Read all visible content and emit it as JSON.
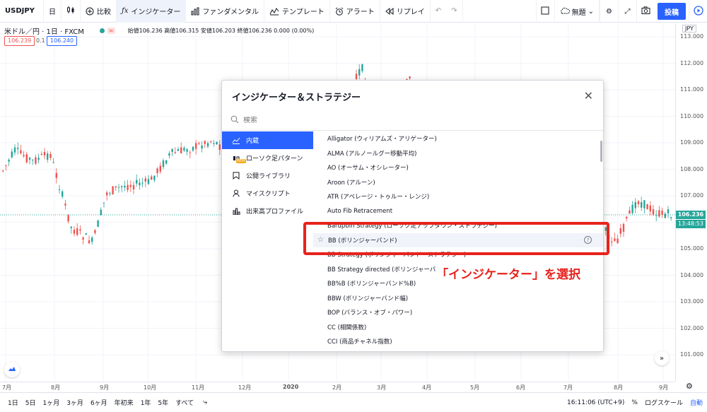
{
  "topbar": {
    "symbol": "USDJPY",
    "interval": "日",
    "compare_label": "比較",
    "indicator_label": "インジケーター",
    "fundamental_label": "ファンダメンタル",
    "template_label": "テンプレート",
    "alert_label": "アラート",
    "replay_label": "リプレイ",
    "layout_label": "無題",
    "post_label": "投稿"
  },
  "legend": {
    "title": "米ドル／円 · 1日 · FXCM",
    "ohlc": "始値106.236 高値106.315 安値106.203 終値106.236 0.000 (0.00%)",
    "bid": "106.239",
    "spread": "0.1",
    "ask": "106.240"
  },
  "price_axis": {
    "currency": "JPY",
    "ticks": [
      "113.000",
      "112.000",
      "111.000",
      "110.000",
      "109.000",
      "108.000",
      "107.000",
      "106.000",
      "105.000",
      "104.000",
      "103.000",
      "102.000",
      "101.000"
    ],
    "last_price": "106.236",
    "countdown": "13:48:53"
  },
  "time_axis": {
    "ticks": [
      "7月",
      "8月",
      "9月",
      "10月",
      "11月",
      "12月",
      "2020",
      "2月",
      "3月",
      "4月",
      "5月",
      "6月",
      "7月",
      "8月",
      "9月"
    ]
  },
  "bottombar": {
    "ranges": [
      "1日",
      "5日",
      "1ヶ月",
      "3ヶ月",
      "6ヶ月",
      "年初来",
      "1年",
      "5年",
      "すべて"
    ],
    "clock": "16:11:06 (UTC+9)",
    "percent": "%",
    "log_scale": "ログスケール",
    "auto": "自動"
  },
  "modal": {
    "title": "インジケーター＆ストラテジー",
    "search_placeholder": "検索",
    "sidebar": [
      {
        "label": "内蔵",
        "icon": "builtin-icon"
      },
      {
        "label": "ローソク足パターン",
        "icon": "candles-icon",
        "badge": "NEW"
      },
      {
        "label": "公開ライブラリ",
        "icon": "bookmark-icon"
      },
      {
        "label": "マイスクリプト",
        "icon": "user-icon"
      },
      {
        "label": "出来高プロファイル",
        "icon": "volume-profile-icon"
      }
    ],
    "items": [
      "Alligator (ウィリアムズ・アリゲーター)",
      "ALMA (アルノールグー移動平均)",
      "AO (オーサム・オシレーター)",
      "Aroon (アルーン)",
      "ATR (アベレージ・トゥルー・レンジ)",
      "Auto Fib Retracement",
      "Barupbin Strategy (ローソク足アップダウン・ストラテジー)",
      "BB (ボリンジャーバンド)",
      "BB Strategy (ボリンジャーバンド・ストラテジー)",
      "BB Strategy directed (ボリンジャーバ",
      "BB%B (ボリンジャーバンド%B)",
      "BBW (ボリンジャーバンド幅)",
      "BOP (バランス・オブ・パワー)",
      "CC (相関係数)",
      "CCI (商品チャネル指数)"
    ]
  },
  "annotation": {
    "callout": "「インジケーター」を選択"
  },
  "colors": {
    "up": "#26a69a",
    "down": "#ef5350",
    "accent": "#2962ff",
    "highlight": "#e8221c"
  }
}
